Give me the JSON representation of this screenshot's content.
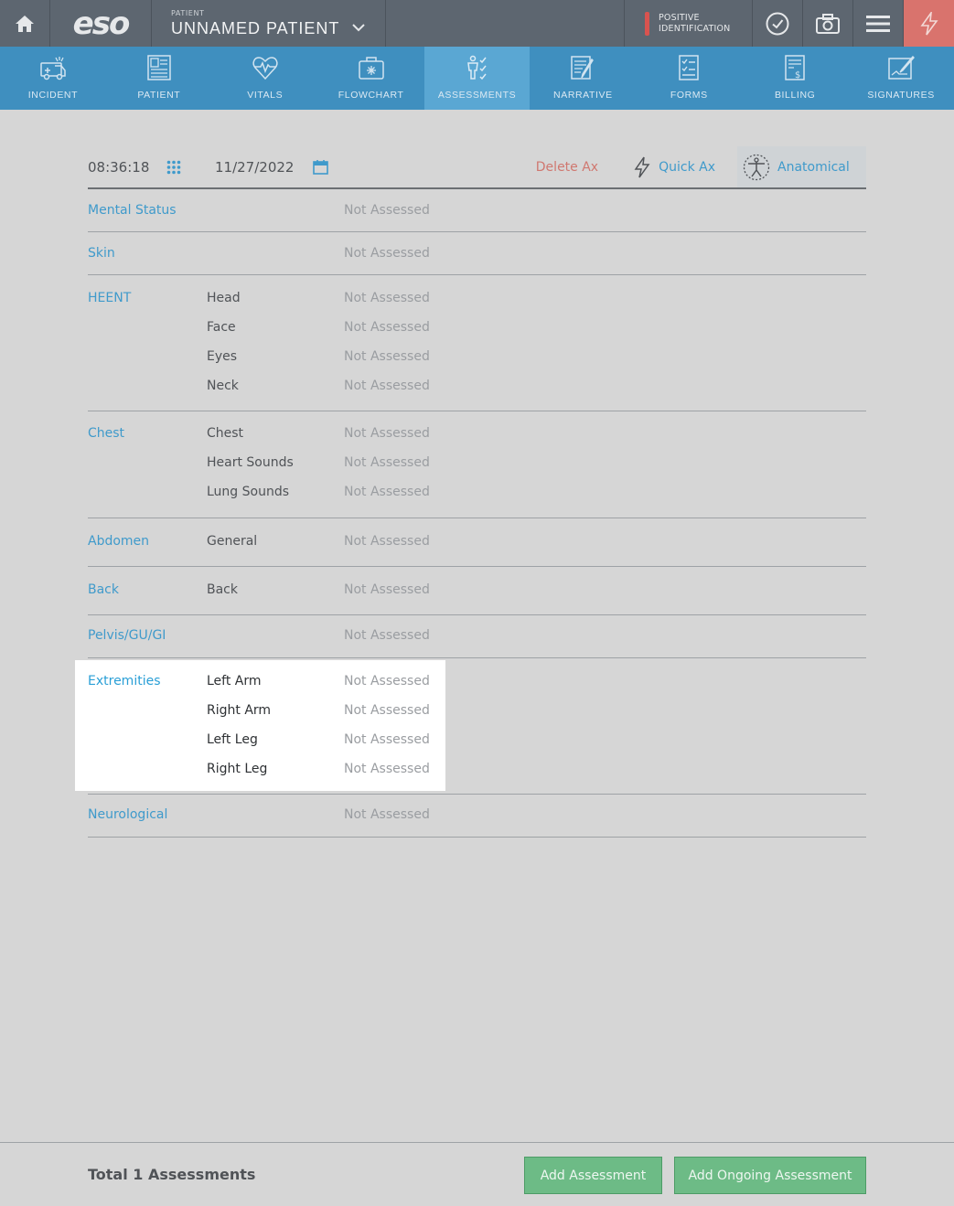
{
  "topbar": {
    "logo": "eso",
    "patient_label": "PATIENT",
    "patient_name": "UNNAMED PATIENT",
    "positive_id_line1": "POSITIVE",
    "positive_id_line2": "IDENTIFICATION"
  },
  "nav": {
    "items": [
      {
        "label": "INCIDENT",
        "icon": "ambulance-icon"
      },
      {
        "label": "PATIENT",
        "icon": "patient-card-icon"
      },
      {
        "label": "VITALS",
        "icon": "heartbeat-icon"
      },
      {
        "label": "FLOWCHART",
        "icon": "medkit-icon"
      },
      {
        "label": "ASSESSMENTS",
        "icon": "body-check-icon"
      },
      {
        "label": "NARRATIVE",
        "icon": "document-pen-icon"
      },
      {
        "label": "FORMS",
        "icon": "checklist-icon"
      },
      {
        "label": "BILLING",
        "icon": "invoice-icon"
      },
      {
        "label": "SIGNATURES",
        "icon": "signature-icon"
      }
    ],
    "active": "ASSESSMENTS"
  },
  "toolbar": {
    "time": "08:36:18",
    "date": "11/27/2022",
    "delete_label": "Delete Ax",
    "quick_label": "Quick Ax",
    "anatomical_label": "Anatomical"
  },
  "sections": [
    {
      "category": "Mental Status",
      "rows": [
        {
          "sub": "",
          "value": "Not Assessed"
        }
      ]
    },
    {
      "category": "Skin",
      "rows": [
        {
          "sub": "",
          "value": "Not Assessed"
        }
      ]
    },
    {
      "category": "HEENT",
      "rows": [
        {
          "sub": "Head",
          "value": "Not Assessed"
        },
        {
          "sub": "Face",
          "value": "Not Assessed"
        },
        {
          "sub": "Eyes",
          "value": "Not Assessed"
        },
        {
          "sub": "Neck",
          "value": "Not Assessed"
        }
      ]
    },
    {
      "category": "Chest",
      "rows": [
        {
          "sub": "Chest",
          "value": "Not Assessed"
        },
        {
          "sub": "Heart Sounds",
          "value": "Not Assessed"
        },
        {
          "sub": "Lung Sounds",
          "value": "Not Assessed"
        }
      ]
    },
    {
      "category": "Abdomen",
      "rows": [
        {
          "sub": "General",
          "value": "Not Assessed"
        }
      ]
    },
    {
      "category": "Back",
      "rows": [
        {
          "sub": "Back",
          "value": "Not Assessed"
        }
      ]
    },
    {
      "category": "Pelvis/GU/GI",
      "rows": [
        {
          "sub": "",
          "value": "Not Assessed"
        }
      ]
    },
    {
      "category": "Extremities",
      "highlighted": true,
      "rows": [
        {
          "sub": "Left Arm",
          "value": "Not Assessed"
        },
        {
          "sub": "Right Arm",
          "value": "Not Assessed"
        },
        {
          "sub": "Left Leg",
          "value": "Not Assessed"
        },
        {
          "sub": "Right Leg",
          "value": "Not Assessed"
        }
      ]
    },
    {
      "category": "Neurological",
      "rows": [
        {
          "sub": "",
          "value": "Not Assessed"
        }
      ]
    }
  ],
  "footer": {
    "total": "Total 1 Assessments",
    "add_label": "Add Assessment",
    "ongoing_label": "Add Ongoing Assessment"
  }
}
